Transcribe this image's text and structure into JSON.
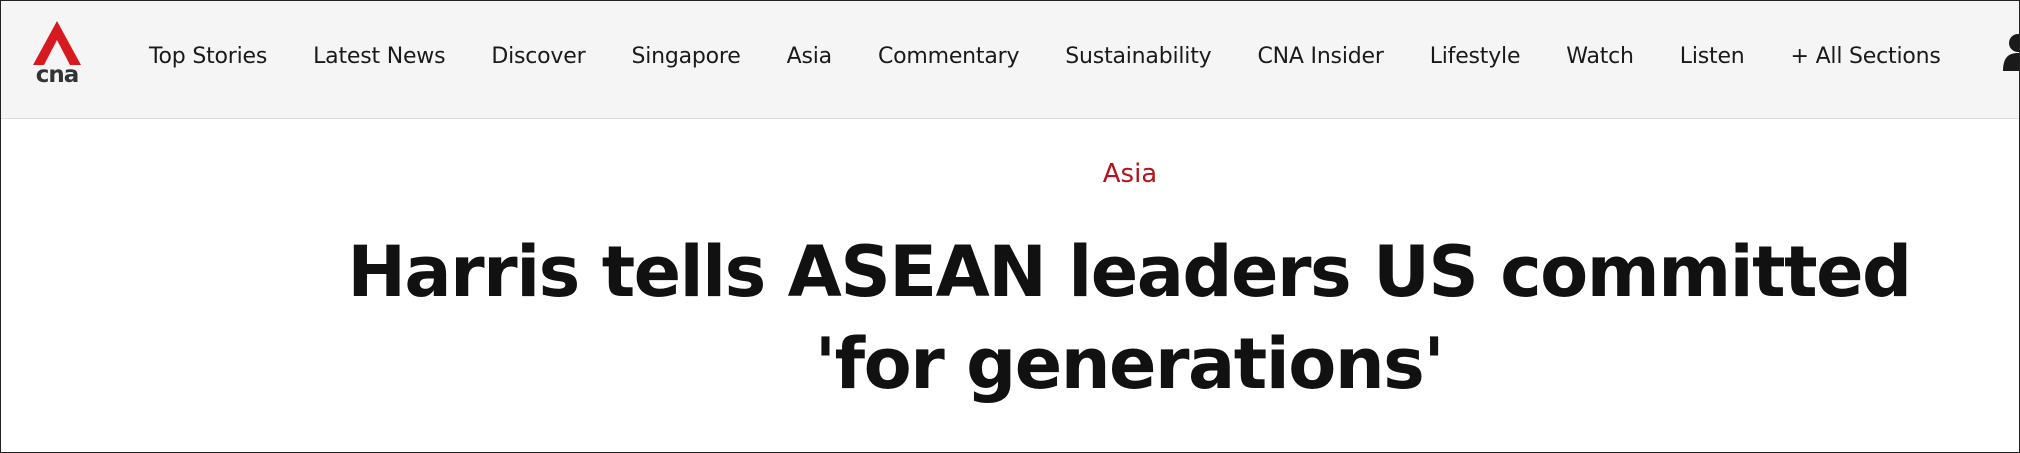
{
  "brand": {
    "logo_text": "cna",
    "logo_color": "#d71920"
  },
  "nav": {
    "items": [
      "Top Stories",
      "Latest News",
      "Discover",
      "Singapore",
      "Asia",
      "Commentary",
      "Sustainability",
      "CNA Insider",
      "Lifestyle",
      "Watch",
      "Listen",
      "+ All Sections"
    ],
    "user_icon": "user-icon"
  },
  "article": {
    "category": "Asia",
    "category_color": "#b4121c",
    "title": "Harris tells ASEAN leaders US committed 'for generations'"
  }
}
